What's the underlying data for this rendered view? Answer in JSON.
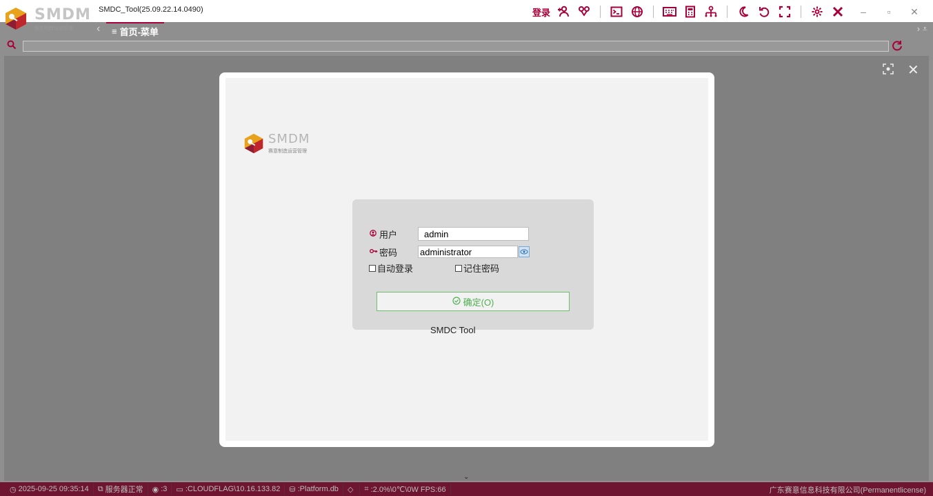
{
  "app": {
    "logo_text": "SMDM",
    "logo_subtitle": "赛意制造运营管理",
    "title": "SMDC_Tool(25.09.22.14.0490)"
  },
  "toolbar": {
    "login_label": "登录",
    "icons": [
      "add-user-icon",
      "link-icon",
      "terminal-icon",
      "globe-icon",
      "keyboard-icon",
      "calculator-icon",
      "network-icon",
      "moon-icon",
      "undo-icon",
      "fullscreen-icon",
      "gear-icon",
      "tools-icon"
    ],
    "window": [
      "minimize-icon",
      "restore-icon",
      "close-icon"
    ]
  },
  "tabs": [
    {
      "label": "首页-菜单",
      "active": true
    }
  ],
  "search": {
    "value": ""
  },
  "login": {
    "brand": "SMDM",
    "brand_subtitle": "赛意制造运营管理",
    "user_label": "用户",
    "user_value": "admin",
    "password_label": "密码",
    "password_value": "administrator",
    "auto_login_label": "自动登录",
    "remember_label": "记住密码",
    "confirm_label": "确定(O)",
    "tool_name": "SMDC Tool"
  },
  "status": {
    "datetime": "2025-09-25 09:35:14",
    "server": "服务器正常",
    "users": ":3",
    "host": ":CLOUDFLAG\\10.16.133.82",
    "db": ":Platform.db",
    "perf": ":2.0%\\0℃\\0W  FPS:66",
    "company": "广东赛意信息科技有限公司(Permanentlicense)"
  },
  "colors": {
    "accent": "#a8003a",
    "status_bg": "#6e1631",
    "ok_green": "#4fb04f"
  }
}
